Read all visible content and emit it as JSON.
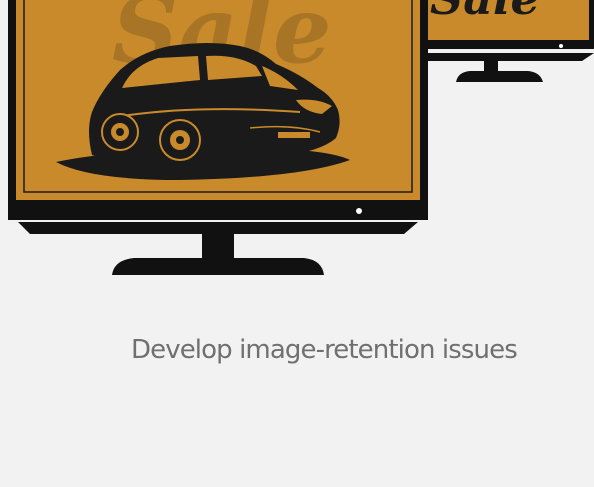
{
  "illustration": {
    "front_monitor": {
      "sale_text": "Sale",
      "icon": "car-silhouette-icon"
    },
    "back_monitor": {
      "sale_text": "Sale"
    },
    "colors": {
      "screen": "#c88a2b",
      "sale_text": "#a87526",
      "bezel": "#111111",
      "car": "#1a1a1a",
      "background": "#f2f2f2"
    }
  },
  "caption": "Develop image-retention issues"
}
